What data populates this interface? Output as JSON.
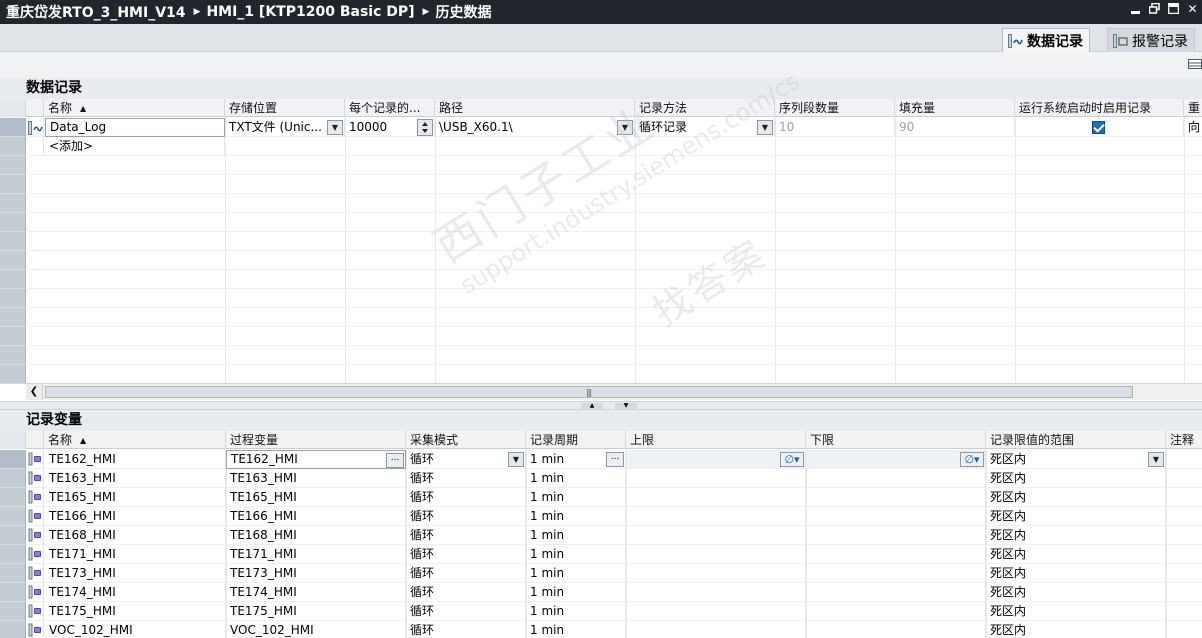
{
  "breadcrumb": {
    "items": [
      "重庆岱发RTO_3_HMI_V14",
      "HMI_1 [KTP1200 Basic DP]",
      "历史数据"
    ]
  },
  "tabs": {
    "data_log_label": "数据记录",
    "alarm_log_label": "报警记录"
  },
  "data_logs_section": {
    "title": "数据记录",
    "columns": [
      "名称",
      "存储位置",
      "每个记录的...",
      "路径",
      "记录方法",
      "序列段数量",
      "填充量",
      "运行系统启动时启用记录",
      "重"
    ],
    "rows": [
      {
        "name": "Data_Log",
        "storage": "TXT文件 (Unic...",
        "records": "10000",
        "path": "\\USB_X60.1\\",
        "method": "循环记录",
        "segments": "10",
        "fill": "90",
        "enable_on_start": true,
        "restart": "向"
      }
    ],
    "add_label": "<添加>"
  },
  "log_tags_section": {
    "title": "记录变量",
    "columns": [
      "名称",
      "过程变量",
      "采集模式",
      "记录周期",
      "上限",
      "下限",
      "记录限值的范围",
      "注释"
    ],
    "rows": [
      {
        "name": "TE162_HMI",
        "process": "TE162_HMI",
        "mode": "循环",
        "cycle": "1 min",
        "range": "死区内"
      },
      {
        "name": "TE163_HMI",
        "process": "TE163_HMI",
        "mode": "循环",
        "cycle": "1 min",
        "range": "死区内"
      },
      {
        "name": "TE165_HMI",
        "process": "TE165_HMI",
        "mode": "循环",
        "cycle": "1 min",
        "range": "死区内"
      },
      {
        "name": "TE166_HMI",
        "process": "TE166_HMI",
        "mode": "循环",
        "cycle": "1 min",
        "range": "死区内"
      },
      {
        "name": "TE168_HMI",
        "process": "TE168_HMI",
        "mode": "循环",
        "cycle": "1 min",
        "range": "死区内"
      },
      {
        "name": "TE171_HMI",
        "process": "TE171_HMI",
        "mode": "循环",
        "cycle": "1 min",
        "range": "死区内"
      },
      {
        "name": "TE173_HMI",
        "process": "TE173_HMI",
        "mode": "循环",
        "cycle": "1 min",
        "range": "死区内"
      },
      {
        "name": "TE174_HMI",
        "process": "TE174_HMI",
        "mode": "循环",
        "cycle": "1 min",
        "range": "死区内"
      },
      {
        "name": "TE175_HMI",
        "process": "TE175_HMI",
        "mode": "循环",
        "cycle": "1 min",
        "range": "死区内"
      },
      {
        "name": "VOC_102_HMI",
        "process": "VOC_102_HMI",
        "mode": "循环",
        "cycle": "1 min",
        "range": "死区内"
      }
    ]
  },
  "watermark": {
    "line1": "西门子工业",
    "line2": "support.industry.siemens.com/cs",
    "line3": "找答案"
  },
  "colors": {
    "titlebar": "#21262c",
    "gutter": "#c4ccd4",
    "checkbox": "#1e6fb8"
  }
}
